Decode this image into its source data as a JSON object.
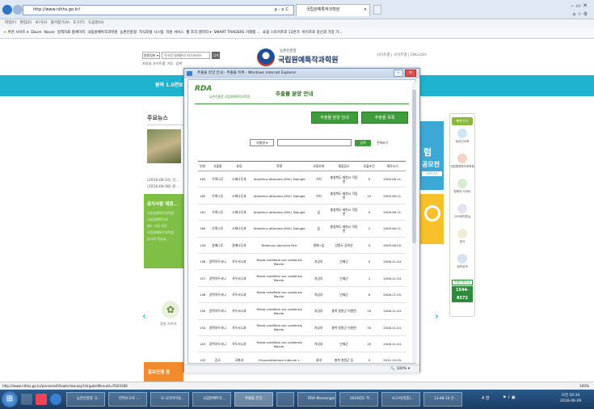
{
  "browser": {
    "url": "http://www.nihhs.go.kr/",
    "search_hint": "ρ - ≥ C",
    "tab_title": "국립원예특작과학원",
    "menu": [
      "파일(F)",
      "편집(E)",
      "보기(V)",
      "즐겨찾기(A)",
      "도구(T)",
      "도움말(H)"
    ],
    "favorites": [
      "추천 사이트 ▾",
      "Daum",
      "Naver",
      "정책자료 홈페이지",
      "국립원예특작과학원",
      "농촌진흥청",
      "지식포털 시스템",
      "지원 서비스",
      "웹 조각 갤러리 ▾",
      "SMART TRADERS 거래를 ...",
      "쇼핑 스토어프로 11번가",
      "아이프로 당신과 가장 가..."
    ],
    "status_url": "http://www.nihhs.go.kr/personal/Viewlerlaw.asp?strgubnMenuId=P103160",
    "zoom": "100%"
  },
  "site": {
    "select_label": "원원정보 ▾",
    "search_placeholder": "전국민 원예관리 지식서비스",
    "search_btn": "검색",
    "links": [
      "자료실 사이트맵",
      "지도",
      "검색 "
    ],
    "org_small": "농촌진흥청",
    "org_name": "국립원예특작과학원",
    "top_links": "사이트맵 | 사이트맵 | ENGLISH",
    "banner_text": "원하 1.0연보",
    "news_title": "주요뉴스",
    "news_dates": [
      "(2016-06-16) 선...",
      "(2016-06-08) 원..."
    ],
    "green_panel_title": "공지사항 제정...",
    "green_panel_lines": [
      "국립원예특작과학원",
      "국립원예특작과",
      "패드 가정 개선",
      "국립원예특작과학원",
      "농사료 학술세..."
    ],
    "bottom_label": "장원 가주가",
    "bottom_green": "홍보진행 중",
    "right_label_1": "럼",
    "right_label_2": "공모전",
    "right_btn": "바로가기",
    "quick_title": "빠른가기",
    "quick_items": [
      "농업인교육",
      "국립원예특작과학원",
      "원예작 사이트",
      "사이버민원실",
      "문서",
      "정보공개"
    ],
    "phone_label": "민원신청안내",
    "phone": "1544-8572"
  },
  "popup": {
    "window_title": "추출물 분양 안내 - 추출물 목록 - Windows Internet Explorer",
    "logo_rda": "RDA",
    "logo_org": "농촌진흥청 국립원예특작과학원",
    "heading": "추출물 분양 안내",
    "btn_info": "추출물 분양 안내",
    "btn_list": "추출물 목록",
    "filter_select": "식물명 ▾",
    "filter_btn": "검색",
    "filter_btn2": "전체보기",
    "columns": [
      "번호",
      "식물명",
      "분류",
      "학명",
      "사용부위",
      "채집장소",
      "추출조건",
      "제작시기"
    ],
    "rows": [
      [
        "163",
        "가죽나무",
        "소태나무과",
        "Ailanthus altissima (Mill.) Swingle",
        "가지",
        "충청북도 제천시 덕동면",
        "9",
        "2009.06.11."
      ],
      [
        "162",
        "가죽나무",
        "소태나무과",
        "Ailanthus altissima (Mill.) Swingle",
        "가지",
        "충청북도 제천시 덕동면",
        "10",
        "2009.06.11."
      ],
      [
        "161",
        "가죽나무",
        "소태나무과",
        "Ailanthus altissima (Mill.) Swingle",
        "잎",
        "충청북도 제천시 덕동면",
        "9",
        "2009.06.11."
      ],
      [
        "160",
        "가죽나무",
        "소태나무과",
        "Ailanthus altissima (Mill.) Swingle",
        "잎",
        "충청북도 제천시 덕동면",
        "2",
        "2009.06.11."
      ],
      [
        "159",
        "갈매나무",
        "갈매나무과",
        "Rhamnus davurica Pall.",
        "열매+잎",
        "강원도 강외산",
        "9",
        "2009.06.05."
      ],
      [
        "158",
        "갈퀴꼭두서니",
        "꼭두서니과",
        "Rubia cordifolia var. pratensis Maxim.",
        "지상부",
        "인제군",
        "9",
        "2008.11.04."
      ],
      [
        "157",
        "갈퀴꼭두서니",
        "꼭두서니과",
        "Rubia cordifolia var. pratensis Maxim.",
        "지상부",
        "인제군",
        "2",
        "2008.11.04."
      ],
      [
        "156",
        "갈퀴꼭두서니",
        "꼭두서니과",
        "Rubia cordifolia var. pratensis Maxim.",
        "지상부",
        "인제군",
        "6",
        "2008.11.05."
      ],
      [
        "155",
        "갈퀴꼭두서니",
        "꼭두서니과",
        "Rubia cordifolia var. pratensis Maxim.",
        "지상부",
        "충북 청원군 미원면",
        "20",
        "2008.11.04."
      ],
      [
        "154",
        "갈퀴꼭두서니",
        "꼭두서니과",
        "Rubia cordifolia var. pratensis Maxim.",
        "지상부",
        "충북 청원군 미원면",
        "35",
        "2008.11.04."
      ],
      [
        "153",
        "갈퀴꼭두서니",
        "꼭두서니과",
        "Rubia cordifolia var. pratensis Maxim.",
        "지상부",
        "인제군",
        "20",
        "2008.11.04."
      ],
      [
        "152",
        "감국",
        "국화과",
        "Chrysanthemum indicum L.",
        "꽃대",
        "충북 청원군 등",
        "9",
        "2012.10.05."
      ]
    ],
    "status_zoom": "🔍 100% ▾"
  },
  "taskbar": {
    "start": "⊞",
    "items": [
      "농촌진흥청 국...",
      "연락보고서 -...",
      "오 니라아이승...",
      "국립원예특작...",
      "추출물 분양...",
      "",
      "RDA Messenger",
      "2016년도 주...",
      "보고서(최종)...",
      "13-48-14 은..."
    ],
    "tray_lang": "A 한",
    "time": "오전 10:34",
    "date": "2016-06-29",
    "tray_zoom": "● 100%"
  },
  "colors": {
    "cyan_band": "#1fb3d0",
    "popup_green": "#3e9c3a",
    "task_blue": "#1a3c63",
    "phone_green": "#2e8b3a"
  }
}
